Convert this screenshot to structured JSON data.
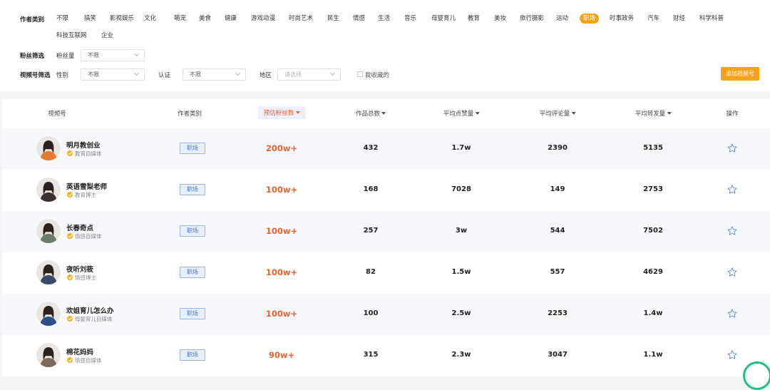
{
  "filters": {
    "category_label": "作者类别",
    "categories": [
      {
        "label": "不限",
        "active": false
      },
      {
        "label": "搞笑",
        "active": false
      },
      {
        "label": "影视娱乐",
        "active": false
      },
      {
        "label": "文化",
        "active": false
      },
      {
        "label": "萌宠",
        "active": false
      },
      {
        "label": "美食",
        "active": false
      },
      {
        "label": "健康",
        "active": false
      },
      {
        "label": "游戏动漫",
        "active": false
      },
      {
        "label": "时尚艺术",
        "active": false
      },
      {
        "label": "民生",
        "active": false
      },
      {
        "label": "情感",
        "active": false
      },
      {
        "label": "生活",
        "active": false
      },
      {
        "label": "音乐",
        "active": false
      },
      {
        "label": "母婴育儿",
        "active": false
      },
      {
        "label": "教育",
        "active": false
      },
      {
        "label": "美妆",
        "active": false
      },
      {
        "label": "旅行摄影",
        "active": false
      },
      {
        "label": "运动",
        "active": false
      },
      {
        "label": "职场",
        "active": true
      },
      {
        "label": "时事政务",
        "active": false
      },
      {
        "label": "汽车",
        "active": false
      },
      {
        "label": "财经",
        "active": false
      },
      {
        "label": "科学科普",
        "active": false
      },
      {
        "label": "科技互联网",
        "active": false
      },
      {
        "label": "企业",
        "active": false
      }
    ],
    "fans_filter_label": "粉丝筛选",
    "fans_count_label": "粉丝量",
    "fans_count_value": "不限",
    "video_filter_label": "视频号筛选",
    "gender_label": "性别",
    "gender_value": "不限",
    "cert_label": "认证",
    "cert_value": "不限",
    "region_label": "地区",
    "region_placeholder": "请选择",
    "favorites_label": "我收藏的",
    "add_button": "添加视频号"
  },
  "table": {
    "headers": {
      "account": "视频号",
      "category": "作者类别",
      "fans": "预估粉丝数",
      "works": "作品总数",
      "likes": "平均点赞量",
      "comments": "平均评论量",
      "shares": "平均转发量",
      "action": "操作"
    },
    "rows": [
      {
        "name": "明月教创业",
        "subtitle": "教育自媒体",
        "category": "职场",
        "fans": "200w+",
        "works": "432",
        "likes": "1.7w",
        "comments": "2390",
        "shares": "5135",
        "avatar_color": "#e87a2e"
      },
      {
        "name": "英语雪梨老师",
        "subtitle": "教育博主",
        "category": "职场",
        "fans": "100w+",
        "works": "168",
        "likes": "7028",
        "comments": "149",
        "shares": "2753",
        "avatar_color": "#3a3032"
      },
      {
        "name": "长春奇点",
        "subtitle": "情感自媒体",
        "category": "职场",
        "fans": "100w+",
        "works": "257",
        "likes": "3w",
        "comments": "544",
        "shares": "7502",
        "avatar_color": "#6b7d6a"
      },
      {
        "name": "夜听刘筱",
        "subtitle": "情感博主",
        "category": "职场",
        "fans": "100w+",
        "works": "82",
        "likes": "1.5w",
        "comments": "557",
        "shares": "4629",
        "avatar_color": "#3b4a66"
      },
      {
        "name": "欢姐育儿怎么办",
        "subtitle": "母婴育儿自媒体",
        "category": "职场",
        "fans": "100w+",
        "works": "100",
        "likes": "2.5w",
        "comments": "2253",
        "shares": "1.4w",
        "avatar_color": "#2d4f86"
      },
      {
        "name": "棉花妈妈",
        "subtitle": "情感自媒体",
        "category": "职场",
        "fans": "90w+",
        "works": "315",
        "likes": "2.3w",
        "comments": "3047",
        "shares": "1.1w",
        "avatar_color": "#7b6a5c"
      }
    ]
  },
  "colors": {
    "accent": "#f5a21b",
    "fans_highlight": "#f0602a",
    "tag_blue": "#4472c4",
    "star_blue": "#5b8bd9"
  }
}
